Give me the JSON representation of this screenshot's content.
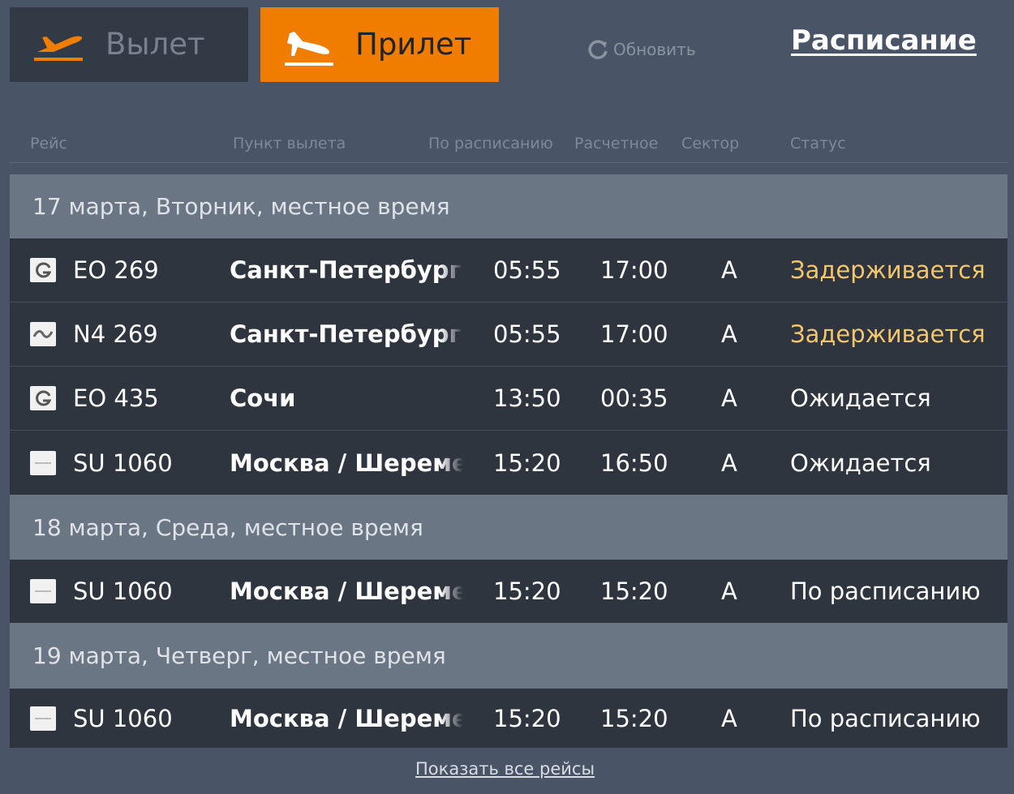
{
  "tabs": {
    "departure_label": "Вылет",
    "arrival_label": "Прилет"
  },
  "header": {
    "refresh_label": "Обновить",
    "schedule_label": "Расписание"
  },
  "columns": {
    "flight": "Рейс",
    "origin": "Пункт вылета",
    "scheduled": "По расписанию",
    "estimated": "Расчетное",
    "sector": "Сектор",
    "status": "Статус"
  },
  "groups": [
    {
      "date_label": "17 марта, Вторник, местное время",
      "flights": [
        {
          "flight": "EO 269",
          "city": "Санкт-Петербург",
          "scheduled": "05:55",
          "estimated": "17:00",
          "sector": "A",
          "status": "Задерживается",
          "airline_icon": "pegas-logo-icon"
        },
        {
          "flight": "N4 269",
          "city": "Санкт-Петербург",
          "scheduled": "05:55",
          "estimated": "17:00",
          "sector": "A",
          "status": "Задерживается",
          "airline_icon": "nordwind-logo-icon"
        },
        {
          "flight": "EO 435",
          "city": "Сочи",
          "scheduled": "13:50",
          "estimated": "00:35",
          "sector": "A",
          "status": "Ожидается",
          "airline_icon": "pegas-logo-icon"
        },
        {
          "flight": "SU 1060",
          "city": "Москва / Шереметьево",
          "scheduled": "15:20",
          "estimated": "16:50",
          "sector": "A",
          "status": "Ожидается",
          "airline_icon": "aeroflot-logo-icon"
        }
      ]
    },
    {
      "date_label": "18 марта, Среда, местное время",
      "flights": [
        {
          "flight": "SU 1060",
          "city": "Москва / Шереметьево",
          "scheduled": "15:20",
          "estimated": "15:20",
          "sector": "A",
          "status": "По расписанию",
          "airline_icon": "aeroflot-logo-icon"
        }
      ]
    },
    {
      "date_label": "19 марта, Четверг, местное время",
      "flights": [
        {
          "flight": "SU 1060",
          "city": "Москва / Шереметьево",
          "scheduled": "15:20",
          "estimated": "15:20",
          "sector": "A",
          "status": "По расписанию",
          "airline_icon": "aeroflot-logo-icon"
        }
      ]
    }
  ],
  "footer": {
    "show_all_label": "Показать все рейсы"
  },
  "colors": {
    "background": "#495566",
    "accent": "#f07d00",
    "delayed_status": "#f3c56d"
  }
}
